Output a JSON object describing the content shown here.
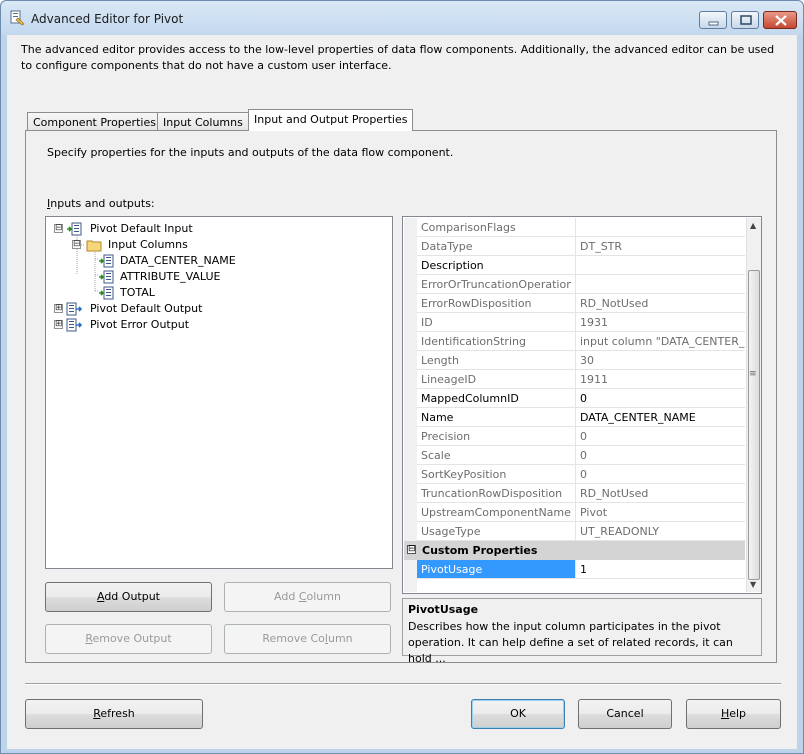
{
  "window": {
    "title": "Advanced Editor for Pivot",
    "description": "The advanced editor provides access to the low-level properties of data flow components. Additionally, the advanced editor can be used to configure components that do not have a custom user interface."
  },
  "tabs": [
    {
      "label": "Component Properties",
      "active": false
    },
    {
      "label": "Input Columns",
      "active": false
    },
    {
      "label": "Input and Output Properties",
      "active": true
    }
  ],
  "panel": {
    "description": "Specify properties for the inputs and outputs of the data flow component.",
    "io_label_mnemonic": "I",
    "io_label_rest": "nputs and outputs:"
  },
  "tree": {
    "items": [
      {
        "label": "Pivot Default Input",
        "expander": "⊟",
        "icon": "input-icon"
      },
      {
        "label": "Input Columns",
        "expander": "⊟",
        "icon": "folder-icon"
      },
      {
        "label": "DATA_CENTER_NAME",
        "icon": "column-icon"
      },
      {
        "label": "ATTRIBUTE_VALUE",
        "icon": "column-icon"
      },
      {
        "label": "TOTAL",
        "icon": "column-icon"
      },
      {
        "label": "Pivot Default Output",
        "expander": "⊞",
        "icon": "output-icon"
      },
      {
        "label": "Pivot Error Output",
        "expander": "⊞",
        "icon": "output-icon"
      }
    ]
  },
  "buttons": {
    "add_output": {
      "mnemonic": "A",
      "rest": "dd Output"
    },
    "add_column": {
      "before": "Add ",
      "mnemonic": "C",
      "rest": "olumn"
    },
    "remove_output": {
      "mnemonic": "R",
      "rest": "emove Output"
    },
    "remove_column": {
      "before": "Remove Co",
      "mnemonic": "l",
      "rest": "umn"
    },
    "refresh": {
      "mnemonic": "R",
      "rest": "efresh"
    },
    "ok": "OK",
    "cancel": "Cancel",
    "help": {
      "mnemonic": "H",
      "rest": "elp"
    }
  },
  "properties": {
    "rows": [
      {
        "name": "ComparisonFlags",
        "value": "",
        "bold": false
      },
      {
        "name": "DataType",
        "value": "DT_STR",
        "bold": false
      },
      {
        "name": "Description",
        "value": "",
        "bold": true
      },
      {
        "name": "ErrorOrTruncationOperation",
        "value": "",
        "bold": false
      },
      {
        "name": "ErrorRowDisposition",
        "value": "RD_NotUsed",
        "bold": false
      },
      {
        "name": "ID",
        "value": "1931",
        "bold": false
      },
      {
        "name": "IdentificationString",
        "value": "input column \"DATA_CENTER_N",
        "bold": false
      },
      {
        "name": "Length",
        "value": "30",
        "bold": false
      },
      {
        "name": "LineageID",
        "value": "1911",
        "bold": false
      },
      {
        "name": "MappedColumnID",
        "value": "0",
        "bold": true
      },
      {
        "name": "Name",
        "value": "DATA_CENTER_NAME",
        "bold": true
      },
      {
        "name": "Precision",
        "value": "0",
        "bold": false
      },
      {
        "name": "Scale",
        "value": "0",
        "bold": false
      },
      {
        "name": "SortKeyPosition",
        "value": "0",
        "bold": false
      },
      {
        "name": "TruncationRowDisposition",
        "value": "RD_NotUsed",
        "bold": false
      },
      {
        "name": "UpstreamComponentName",
        "value": "Pivot",
        "bold": false
      },
      {
        "name": "UsageType",
        "value": "UT_READONLY",
        "bold": false
      }
    ],
    "category": {
      "label": "Custom Properties",
      "expander": "⊟"
    },
    "custom_rows": [
      {
        "name": "PivotUsage",
        "value": "1",
        "selected": true
      }
    ]
  },
  "help": {
    "title": "PivotUsage",
    "description": "Describes how the input column participates in the pivot operation. It can help define a set of related records, it can hold ..."
  },
  "colors": {
    "selection": "#3399ff",
    "window_frame": "#bcd3ea"
  }
}
